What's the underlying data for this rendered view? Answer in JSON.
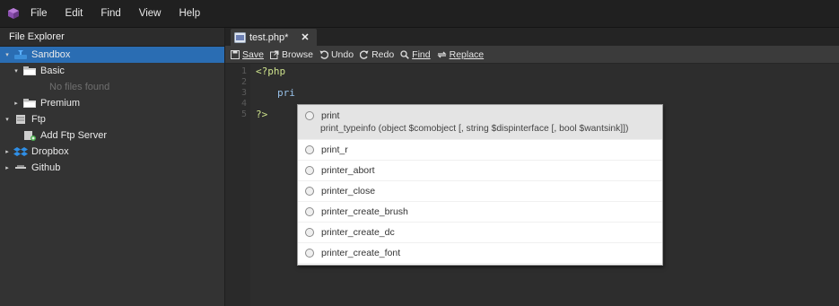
{
  "menu": [
    "File",
    "Edit",
    "Find",
    "View",
    "Help"
  ],
  "sidebar": {
    "title": "File Explorer",
    "items": [
      {
        "label": "Sandbox",
        "icon": "drive-icon",
        "arrow": "▾",
        "indent": 0,
        "selected": true
      },
      {
        "label": "Basic",
        "icon": "folder-icon",
        "arrow": "▾",
        "indent": 1
      },
      {
        "label": "No files found",
        "icon": "",
        "arrow": "",
        "indent": 2,
        "muted": true
      },
      {
        "label": "Premium",
        "icon": "folder-icon",
        "arrow": "▸",
        "indent": 1
      },
      {
        "label": "Ftp",
        "icon": "server-icon",
        "arrow": "▾",
        "indent": 0
      },
      {
        "label": "Add Ftp Server",
        "icon": "add-server-icon",
        "arrow": "",
        "indent": 1
      },
      {
        "label": "Dropbox",
        "icon": "dropbox-icon",
        "arrow": "▸",
        "indent": 0
      },
      {
        "label": "Github",
        "icon": "github-icon",
        "arrow": "▸",
        "indent": 0
      }
    ]
  },
  "editor": {
    "tab": {
      "label": "test.php*",
      "close": "✕"
    },
    "toolbar": {
      "save": "Save",
      "browse": "Browse",
      "undo": "Undo",
      "redo": "Redo",
      "find": "Find",
      "replace": "Replace"
    },
    "line_numbers": [
      "1",
      "2",
      "3",
      "4",
      "5"
    ],
    "lines": [
      "<?php",
      "",
      "pri",
      "",
      "?>"
    ]
  },
  "autocomplete": {
    "selected": {
      "name": "print",
      "signature": "print_typeinfo (object $comobject [, string $dispinterface [, bool $wantsink]])"
    },
    "items": [
      "print_r",
      "printer_abort",
      "printer_close",
      "printer_create_brush",
      "printer_create_dc",
      "printer_create_font"
    ]
  },
  "colors": {
    "accent": "#2a6db3",
    "code_string": "#cde28c",
    "code_keyword": "#97c0e8"
  }
}
